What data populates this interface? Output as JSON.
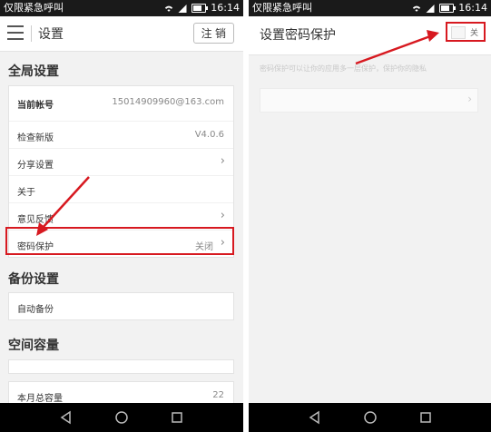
{
  "status_bar": {
    "carrier": "仅限紧急呼叫",
    "time": "16:14"
  },
  "left": {
    "header": {
      "title": "设置",
      "logout_label": "注 销"
    },
    "global_section": {
      "title": "全局设置",
      "rows": [
        {
          "label": "当前帐号",
          "value": "15014909960@163.com"
        },
        {
          "label": "检查新版",
          "value": "V4.0.6"
        },
        {
          "label": "分享设置",
          "value": ""
        },
        {
          "label": "关于",
          "value": ""
        },
        {
          "label": "意见反馈",
          "value": ""
        },
        {
          "label": "密码保护",
          "value": "关闭"
        }
      ]
    },
    "backup_section": {
      "title": "备份设置",
      "rows": [
        {
          "label": "自动备份",
          "value": ""
        }
      ]
    },
    "space_section": {
      "title": "空间容量",
      "rows": [
        {
          "label": "",
          "value": ""
        },
        {
          "label": "本月总容量",
          "value": "22"
        }
      ]
    }
  },
  "right": {
    "header": {
      "title": "设置密码保护"
    },
    "toggle": {
      "label": "关",
      "state": "off"
    },
    "description": "密码保护可以让你的应用多一层保护，保护你的隐私"
  },
  "colors": {
    "accent_red": "#d71920"
  }
}
